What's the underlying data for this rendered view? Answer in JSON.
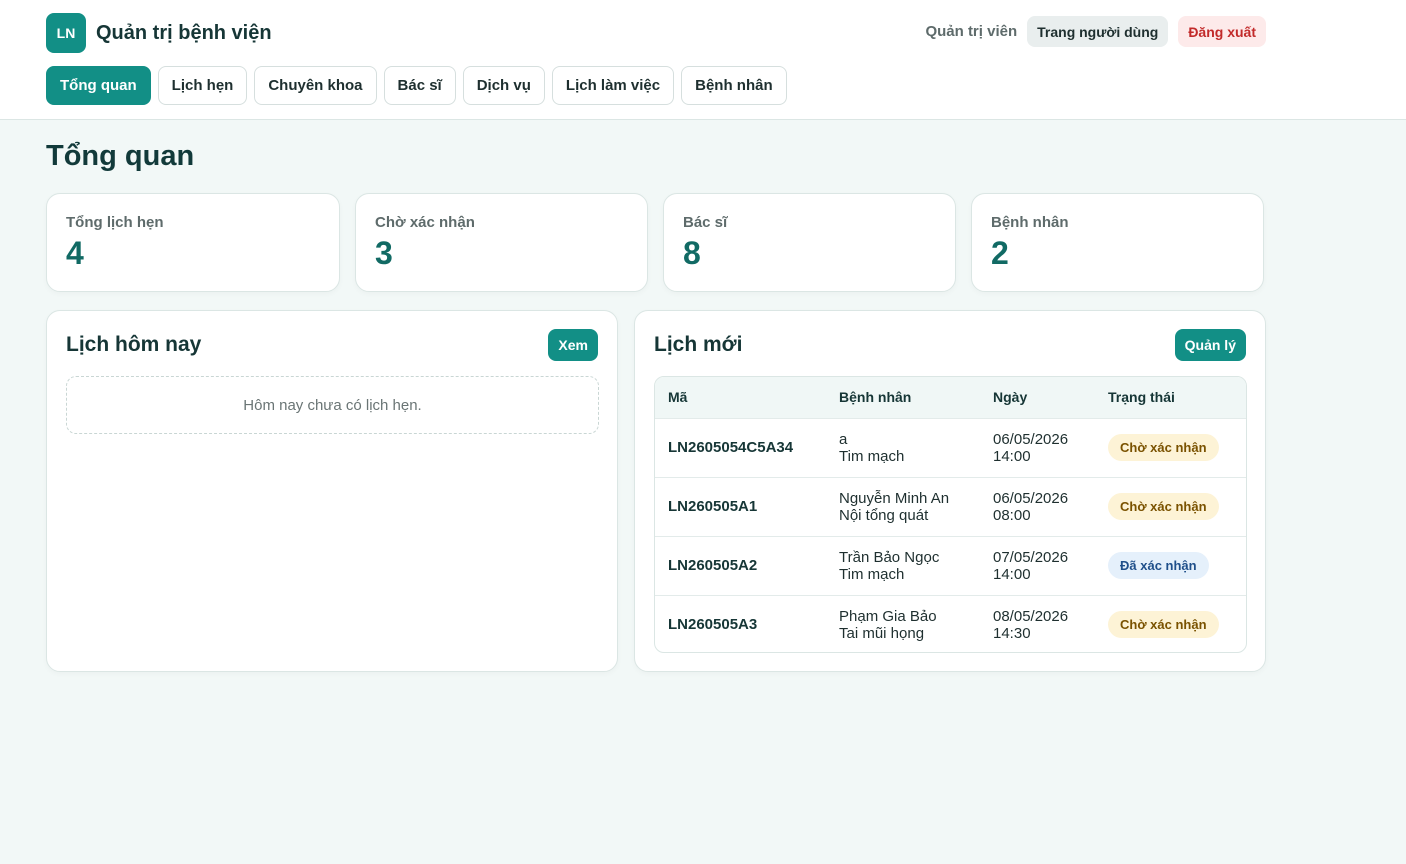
{
  "app": {
    "logo_text": "LN",
    "title": "Quản trị bệnh viện"
  },
  "user": {
    "role": "Quản trị viên",
    "user_page_label": "Trang người dùng",
    "logout_label": "Đăng xuất"
  },
  "nav": {
    "tabs": [
      {
        "label": "Tổng quan",
        "active": true
      },
      {
        "label": "Lịch hẹn",
        "active": false
      },
      {
        "label": "Chuyên khoa",
        "active": false
      },
      {
        "label": "Bác sĩ",
        "active": false
      },
      {
        "label": "Dịch vụ",
        "active": false
      },
      {
        "label": "Lịch làm việc",
        "active": false
      },
      {
        "label": "Bệnh nhân",
        "active": false
      }
    ]
  },
  "page": {
    "title": "Tổng quan"
  },
  "stats": [
    {
      "label": "Tổng lịch hẹn",
      "value": "4"
    },
    {
      "label": "Chờ xác nhận",
      "value": "3"
    },
    {
      "label": "Bác sĩ",
      "value": "8"
    },
    {
      "label": "Bệnh nhân",
      "value": "2"
    }
  ],
  "today": {
    "title": "Lịch hôm nay",
    "view_label": "Xem",
    "empty_text": "Hôm nay chưa có lịch hẹn."
  },
  "recent": {
    "title": "Lịch mới",
    "manage_label": "Quản lý",
    "columns": [
      "Mã",
      "Bệnh nhân",
      "Ngày",
      "Trạng thái"
    ],
    "rows": [
      {
        "code": "LN2605054C5A34",
        "patient": "a",
        "department": "Tim mạch",
        "date": "06/05/2026",
        "time": "14:00",
        "status": "Chờ xác nhận",
        "status_type": "pending"
      },
      {
        "code": "LN260505A1",
        "patient": "Nguyễn Minh An",
        "department": "Nội tổng quát",
        "date": "06/05/2026",
        "time": "08:00",
        "status": "Chờ xác nhận",
        "status_type": "pending"
      },
      {
        "code": "LN260505A2",
        "patient": "Trần Bảo Ngọc",
        "department": "Tim mạch",
        "date": "07/05/2026",
        "time": "14:00",
        "status": "Đã xác nhận",
        "status_type": "confirmed"
      },
      {
        "code": "LN260505A3",
        "patient": "Phạm Gia Bảo",
        "department": "Tai mũi họng",
        "date": "08/05/2026",
        "time": "14:30",
        "status": "Chờ xác nhận",
        "status_type": "pending"
      }
    ]
  },
  "colors": {
    "accent": "#128f86",
    "pending_bg": "#fdf3d6",
    "confirmed_bg": "#e5f0fb",
    "logout_text": "#c22a2a"
  }
}
